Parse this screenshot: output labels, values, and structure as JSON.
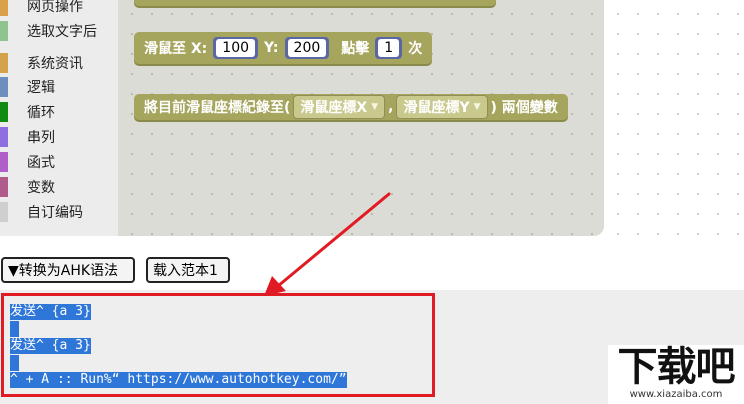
{
  "sidebar": {
    "items": [
      {
        "label": "网页操作",
        "color": "#d9a14a"
      },
      {
        "label": "选取文字后",
        "color": "#8fc48f"
      },
      {
        "label": "系统资讯",
        "color": "#d4a24a"
      },
      {
        "label": "逻辑",
        "color": "#6c8fbf"
      },
      {
        "label": "循环",
        "color": "#108a10"
      },
      {
        "label": "串列",
        "color": "#8f6fe0"
      },
      {
        "label": "函式",
        "color": "#b05fc8"
      },
      {
        "label": "变数",
        "color": "#b05c8a"
      },
      {
        "label": "自订编码",
        "color": "#cfcfcf"
      }
    ]
  },
  "blocks": {
    "mouse_move": {
      "prefix": "滑鼠至 X:",
      "x_value": "100",
      "y_label": "Y:",
      "y_value": "200",
      "click_label": "點擊",
      "click_count": "1",
      "suffix": "次"
    },
    "record_pos": {
      "prefix": "將目前滑鼠座標紀錄至(",
      "var_x": "滑鼠座標X",
      "comma": ",",
      "var_y": "滑鼠座標Y",
      "suffix": ") 兩個變數"
    }
  },
  "toolbar": {
    "convert_label": "▼转换为AHK语法",
    "load_label": "载入范本1"
  },
  "code": {
    "lines": [
      "发送^ {a 3}",
      "",
      "发送^ {a 3}",
      "",
      "^ + A :: Run%“ https://www.autohotkey.com/”"
    ]
  },
  "watermark": {
    "main": "下载吧",
    "sub": "www.xiazaiba.com"
  },
  "colors": {
    "block": "#a5a55e",
    "number_slot": "#5b67a5",
    "selection": "#2e76d8",
    "annotation": "#e01b24"
  }
}
